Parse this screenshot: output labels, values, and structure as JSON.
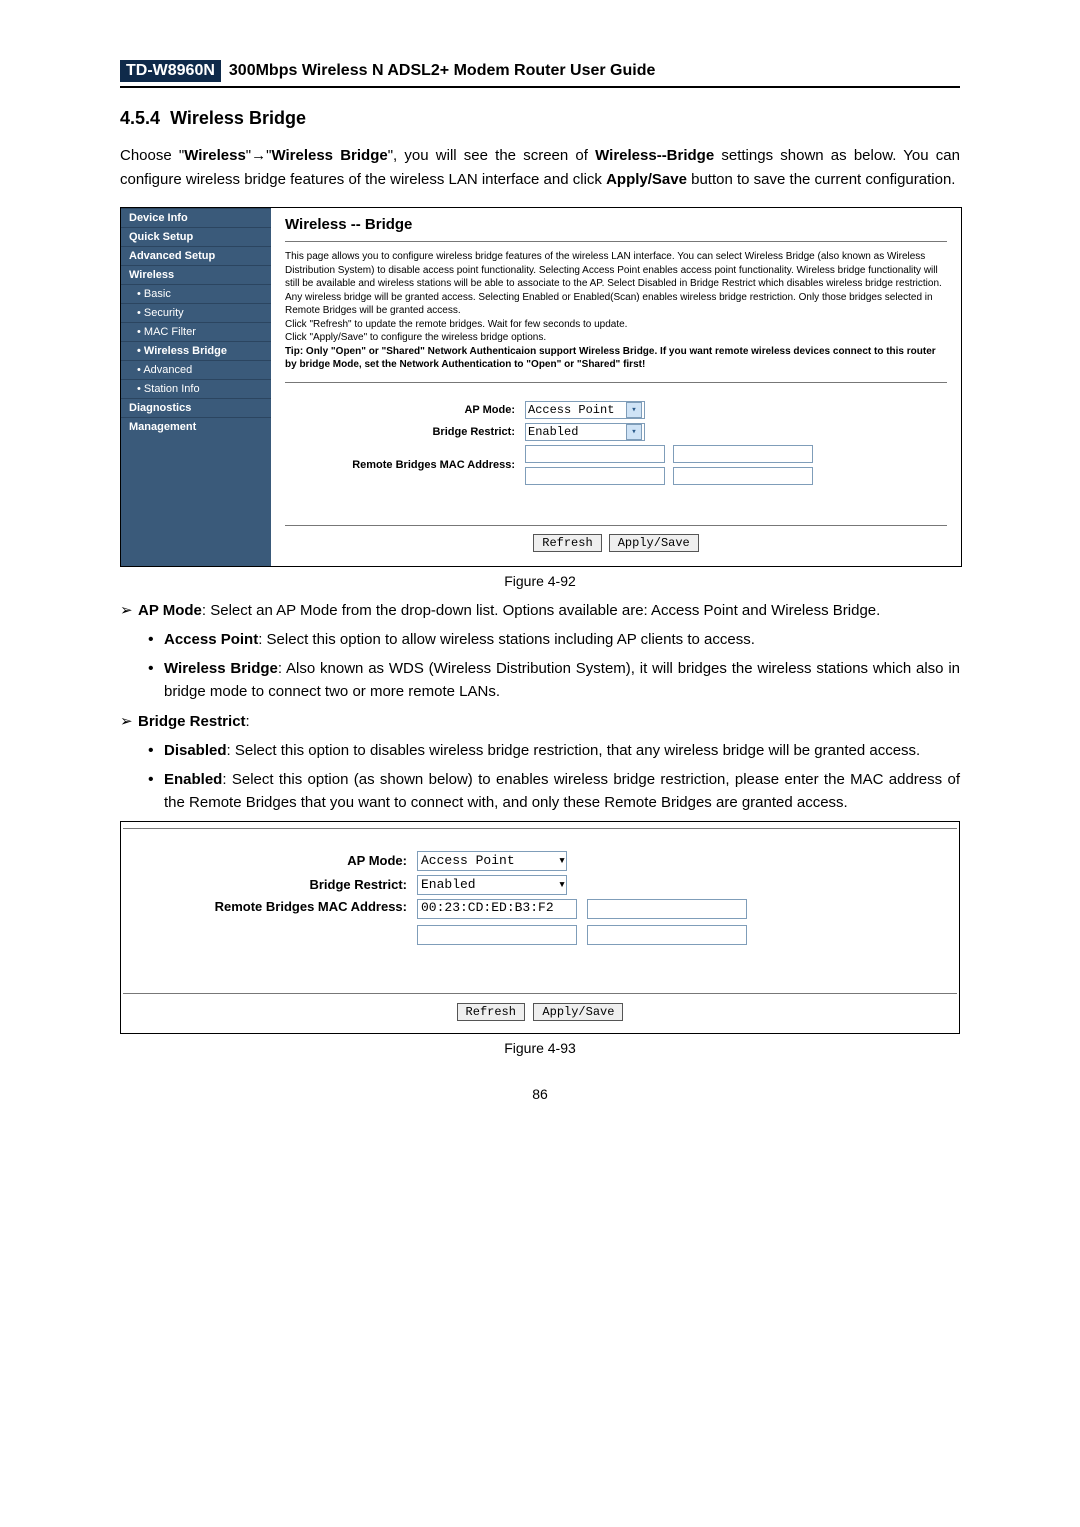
{
  "header": {
    "model": "TD-W8960N",
    "title": "300Mbps Wireless N ADSL2+ Modem Router User Guide"
  },
  "section": {
    "number": "4.5.4",
    "title": "Wireless Bridge"
  },
  "intro": {
    "p1a": "Choose \"",
    "p1b": "Wireless",
    "p1c": "\"",
    "arrow": "→",
    "p1d": "\"",
    "p1e": "Wireless Bridge",
    "p1f": "\", you will see the screen of ",
    "p1g": "Wireless--Bridge",
    "p1h": " settings shown as below. You can configure wireless bridge features of the wireless LAN interface and click ",
    "p1i": "Apply/Save",
    "p1j": " button to save the current configuration."
  },
  "sidebar": [
    {
      "label": "Device Info",
      "sub": false
    },
    {
      "label": "Quick Setup",
      "sub": false
    },
    {
      "label": "Advanced Setup",
      "sub": false
    },
    {
      "label": "Wireless",
      "sub": false
    },
    {
      "label": "Basic",
      "sub": true
    },
    {
      "label": "Security",
      "sub": true
    },
    {
      "label": "MAC Filter",
      "sub": true
    },
    {
      "label": "Wireless Bridge",
      "sub": true,
      "active": true
    },
    {
      "label": "Advanced",
      "sub": true
    },
    {
      "label": "Station Info",
      "sub": true
    },
    {
      "label": "Diagnostics",
      "sub": false
    },
    {
      "label": "Management",
      "sub": false
    }
  ],
  "panel": {
    "title": "Wireless -- Bridge",
    "desc_lines": [
      "This page allows you to configure wireless bridge features of the wireless LAN interface. You can select Wireless Bridge (also known as Wireless Distribution System) to disable access point functionality. Selecting Access Point enables access point functionality. Wireless bridge functionality will still be available and wireless stations will be able to associate to the AP. Select Disabled in Bridge Restrict which disables wireless bridge restriction. Any wireless bridge will be granted access. Selecting Enabled or Enabled(Scan) enables wireless bridge restriction. Only those bridges selected in Remote Bridges will be granted access.",
      "Click \"Refresh\" to update the remote bridges. Wait for few seconds to update.",
      "Click \"Apply/Save\" to configure the wireless bridge options."
    ],
    "tip": "Tip: Only \"Open\" or \"Shared\" Network Authenticaion support Wireless Bridge. If you want remote wireless devices connect to this router by bridge Mode, set the Network Authentication to \"Open\" or \"Shared\" first!",
    "labels": {
      "ap_mode": "AP Mode:",
      "bridge_restrict": "Bridge Restrict:",
      "remote_mac": "Remote Bridges MAC Address:"
    },
    "values": {
      "ap_mode": "Access Point",
      "bridge_restrict": "Enabled"
    },
    "buttons": {
      "refresh": "Refresh",
      "apply": "Apply/Save"
    }
  },
  "fig1_caption": "Figure 4-92",
  "list": {
    "ap_mode_head": "AP Mode",
    "ap_mode_text": ": Select an AP Mode from the drop-down list. Options available are: Access Point and Wireless Bridge.",
    "access_point_head": "Access Point",
    "access_point_text": ": Select this option to allow wireless stations including AP clients to access.",
    "wireless_bridge_head": "Wireless Bridge",
    "wireless_bridge_text": ": Also known as WDS (Wireless Distribution System), it will bridges the wireless stations which also in bridge mode to connect two or more remote LANs.",
    "bridge_restrict_head": "Bridge Restrict",
    "bridge_restrict_text": ":",
    "disabled_head": "Disabled",
    "disabled_text": ": Select this option to disables wireless bridge restriction, that any wireless bridge will be granted access.",
    "enabled_head": "Enabled",
    "enabled_text": ": Select this option (as shown below) to enables wireless bridge restriction, please enter the MAC address of the Remote Bridges that you want to connect with, and only these Remote Bridges are granted access."
  },
  "panel2": {
    "labels": {
      "ap_mode": "AP Mode:",
      "bridge_restrict": "Bridge Restrict:",
      "remote_mac": "Remote Bridges MAC Address:"
    },
    "values": {
      "ap_mode": "Access Point",
      "bridge_restrict": "Enabled",
      "mac1": "00:23:CD:ED:B3:F2"
    },
    "buttons": {
      "refresh": "Refresh",
      "apply": "Apply/Save"
    }
  },
  "fig2_caption": "Figure 4-93",
  "page_number": "86"
}
